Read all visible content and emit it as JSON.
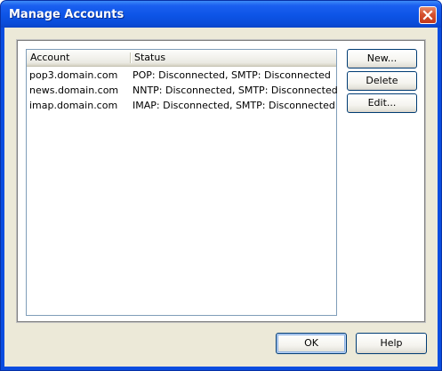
{
  "window": {
    "title": "Manage Accounts",
    "close_icon": "close-icon"
  },
  "listview": {
    "columns": [
      "Account",
      "Status"
    ],
    "rows": [
      {
        "account": "pop3.domain.com",
        "status": "POP: Disconnected, SMTP: Disconnected"
      },
      {
        "account": "news.domain.com",
        "status": "NNTP: Disconnected, SMTP: Disconnected"
      },
      {
        "account": "imap.domain.com",
        "status": "IMAP: Disconnected, SMTP: Disconnected"
      }
    ]
  },
  "side_buttons": {
    "new_label": "New...",
    "delete_label": "Delete",
    "edit_label": "Edit..."
  },
  "bottom_buttons": {
    "ok_label": "OK",
    "help_label": "Help"
  },
  "colors": {
    "titlebar": "#0a4de0",
    "client": "#ece9d8",
    "close_button": "#d5512f"
  }
}
